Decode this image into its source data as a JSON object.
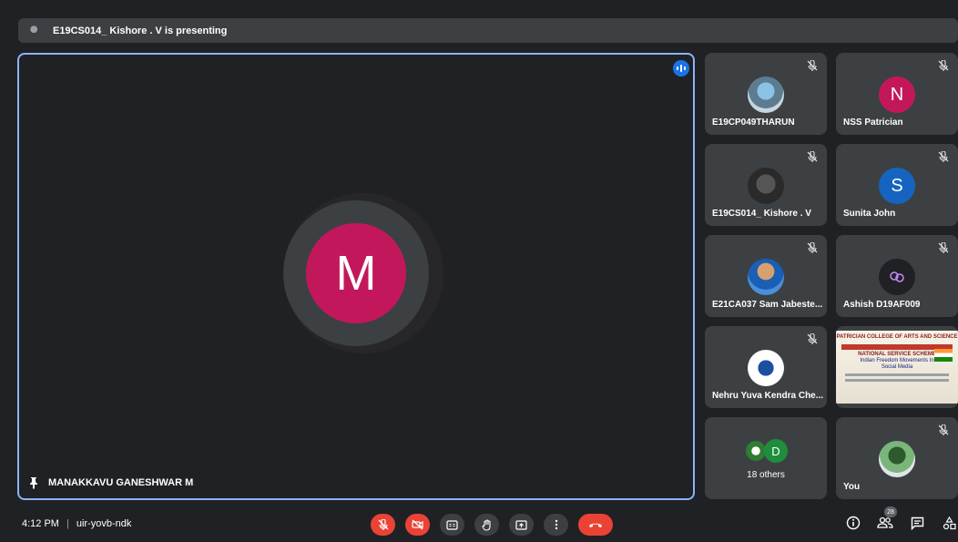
{
  "presenting": {
    "text": "E19CS014_ Kishore . V is presenting"
  },
  "stage": {
    "avatar_letter": "M",
    "avatar_color": "#c2185b",
    "name": "MANAKKAVU GANESHWAR M"
  },
  "tiles": [
    {
      "name": "E19CP049THARUN",
      "type": "photo"
    },
    {
      "name": "NSS Patrician",
      "type": "letter",
      "letter": "N",
      "color": "#c2185b"
    },
    {
      "name": "E19CS014_ Kishore . V",
      "type": "photo"
    },
    {
      "name": "Sunita John",
      "type": "letter",
      "letter": "S",
      "color": "#1565c0"
    },
    {
      "name": "E21CA037 Sam Jabeste...",
      "type": "photo"
    },
    {
      "name": "Ashish D19AF009",
      "type": "icon"
    },
    {
      "name": "Nehru Yuva Kendra Che...",
      "type": "photo"
    },
    {
      "name": "",
      "type": "slide"
    },
    {
      "name": "18 others",
      "type": "others",
      "letter": "D"
    },
    {
      "name": "You",
      "type": "photo"
    }
  ],
  "slide": {
    "college": "PATRICIAN COLLEGE OF ARTS AND SCIENCE",
    "unit": "NATIONAL SERVICE SCHEME",
    "topic_line1": "Indian Freedom Movements In",
    "topic_line2": "Social Media"
  },
  "bottom": {
    "time": "4:12 PM",
    "meeting_code": "uir-yovb-ndk",
    "participant_count": "28"
  },
  "colors": {
    "background": "#202124",
    "tile": "#3c4043",
    "accent": "#8ab4f8",
    "danger": "#ea4335"
  }
}
